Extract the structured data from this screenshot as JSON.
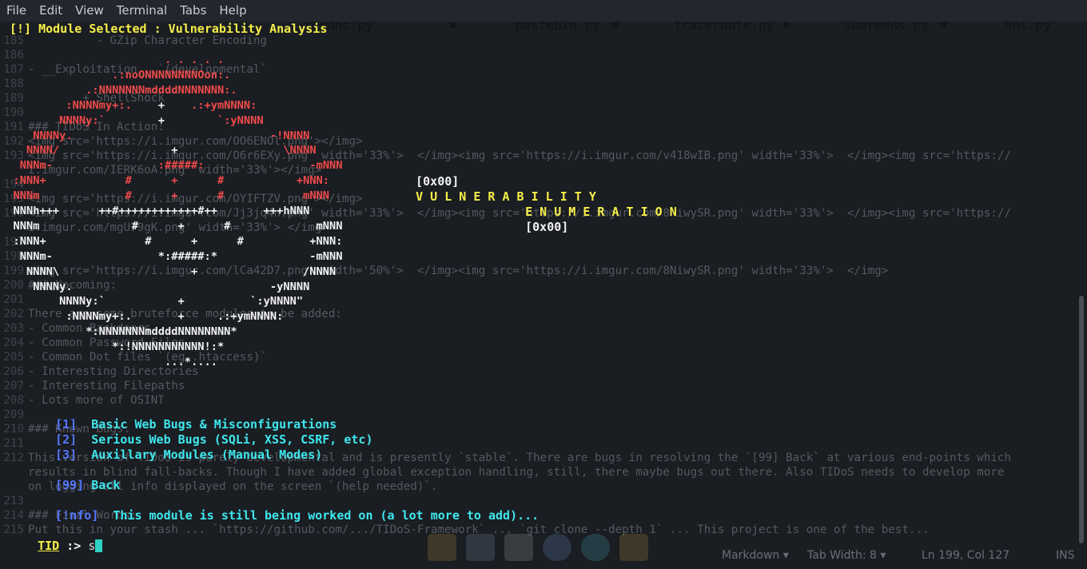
{
  "menubar": {
    "items": [
      "File",
      "Edit",
      "View",
      "Terminal",
      "Tabs",
      "Help"
    ]
  },
  "editor_tabs": [
    {
      "name": "revdns.py"
    },
    {
      "name": "pastebin.py"
    },
    {
      "name": "traceroute.py"
    },
    {
      "name": "sharedns.py"
    },
    {
      "name": "hhi.py"
    }
  ],
  "tab_close_glyph": "✖",
  "background_lines": [
    {
      "ln": "185",
      "text": "          - GZip Character Encoding"
    },
    {
      "ln": "186",
      "text": ""
    },
    {
      "ln": "187",
      "text": "- __Exploitation__ `(developmental`"
    },
    {
      "ln": "188",
      "text": ""
    },
    {
      "ln": "189",
      "text": "        + ShellShock"
    },
    {
      "ln": "190",
      "text": ""
    },
    {
      "ln": "191",
      "text": "### TIDoS In Action:"
    },
    {
      "ln": "192",
      "text": "<img src='https://i.imgur.com/OO6ENOl.png'></img>"
    },
    {
      "ln": "193",
      "text": "<img src='https://i.imgur.com/O6r6EXy.png' width='33%'>  </img><img src='https://i.imgur.com/v418wIB.png' width='33%'>  </img><img src='https://"
    },
    {
      "ln": "",
      "text": "i.imgur.com/IERK6oA.png' width='33%'></img>"
    },
    {
      "ln": "194",
      "text": ""
    },
    {
      "ln": "195",
      "text": "<img src='https://i.imgur.com/OYIFTZV.png'></img>"
    },
    {
      "ln": "196",
      "text": "<img src='https://i.imgur.com/Jj3jq4n.png' width='33%'>  </img><img src='https://i.imgur.com/8NiwySR.png' width='33%'>  </img><img src='https://"
    },
    {
      "ln": "",
      "text": "i.imgur.com/mgU79gK.png' width='33%'> </img>"
    },
    {
      "ln": "197",
      "text": ""
    },
    {
      "ln": "198",
      "text": ""
    },
    {
      "ln": "199",
      "text": "<img src='https://i.imgur.com/lCa42D7.png' width='50%'>  </img><img src='https://i.imgur.com/8NiwySR.png' width='33%'>  </img>"
    },
    {
      "ln": "200",
      "text": "### Upcoming:"
    },
    {
      "ln": "201",
      "text": ""
    },
    {
      "ln": "202",
      "text": "There are some bruteforce modules to be added:"
    },
    {
      "ln": "203",
      "text": "- Common Backdoors"
    },
    {
      "ln": "204",
      "text": "- Common Password Files"
    },
    {
      "ln": "205",
      "text": "- Common Dot files `(eg .htaccess)`"
    },
    {
      "ln": "206",
      "text": "- Interesting Directories"
    },
    {
      "ln": "207",
      "text": "- Interesting Filepaths"
    },
    {
      "ln": "208",
      "text": "- Lots more of OSINT"
    },
    {
      "ln": "209",
      "text": ""
    },
    {
      "ln": "210",
      "text": "### Known Bugs:"
    },
    {
      "ln": "211",
      "text": ""
    },
    {
      "ln": "212",
      "text": "This version of TIDoS is purely developmental and is presently `stable`. There are bugs in resolving the `[99] Back` at various end-points which"
    },
    {
      "ln": "",
      "text": "results in blind fall-backs. Though I have added global exception handling, still, there maybe bugs out there. Also TIDoS needs to develop more"
    },
    {
      "ln": "",
      "text": "on logging all info displayed on the screen `(help needed)`."
    },
    {
      "ln": "213",
      "text": ""
    },
    {
      "ln": "214",
      "text": "### Final Words:"
    },
    {
      "ln": "215",
      "text": "Put this in your stash ... `https://github.com/.../TIDoS-Framework` ... `git clone --depth 1` ... This project is one of the best..."
    }
  ],
  "terminal": {
    "header": "[!] Module Selected : Vulnerability Analysis",
    "art": [
      {
        "c": "red",
        "t": "                         . . . . ."
      },
      {
        "c": "red",
        "t": "                 .:noONNNNNNNNOon:."
      },
      {
        "c": "red",
        "t": "             .:NNNNNNNmddddNNNNNNN:."
      },
      {
        "c": "mix",
        "r": "          :NNNNmy+:.",
        "w": "    +",
        "r2": "    .:+ymNNNN:"
      },
      {
        "c": "mix",
        "r": "         NNNNy:`",
        "w": "        +",
        "r2": "        `:yNNNN"
      },
      {
        "c": "red",
        "t": "     NNNNy.                              -!NNNN"
      },
      {
        "c": "mix",
        "r": "    NNNN/",
        "w": "                 +",
        "r2": "                \\NNNN"
      },
      {
        "c": "mix",
        "r": "   NNNm-",
        "w": "                ",
        "r2": ":#####:",
        "w2": "",
        "r3": "                -mNNN"
      },
      {
        "c": "mix",
        "r": "  :NNN+",
        "w": "            ",
        "r2": "#      +      #",
        "r3": "           +NNN:"
      },
      {
        "c": "mix",
        "r": "  NNNm",
        "w": "             ",
        "r2": "#      +      #",
        "r3": "            mNNN"
      },
      {
        "c": "white",
        "t": "  NNNh+++      ++#++++++++++++#++       +++hNNN"
      },
      {
        "c": "white",
        "t": "  NNNm              #      +      #             mNNN"
      },
      {
        "c": "white",
        "t": "  :NNN+               #      +      #          +NNN:"
      },
      {
        "c": "white",
        "t": "   NNNm-                *:#####:*              -mNNN"
      },
      {
        "c": "white",
        "t": "    NNNN\\                    +                /NNNN"
      },
      {
        "c": "white",
        "t": "     NNNNy.                              -yNNNN"
      },
      {
        "c": "white",
        "t": "         NNNNy:`           +          `:yNNNN\""
      },
      {
        "c": "white",
        "t": "          :NNNNmy+:.       +     .:+ymNNNN:"
      },
      {
        "c": "white",
        "t": "             *:NNNNNNNmddddNNNNNNNN*"
      },
      {
        "c": "white",
        "t": "                 *:!NNNNNNNNNNN!:*"
      },
      {
        "c": "white",
        "t": "                         ...*...."
      }
    ],
    "vuln_line1_tag": "[0x00]",
    "vuln_line1_word": "V U L N E R A B I L I T Y",
    "vuln_line2_word": "E N U M E R A T I O N",
    "vuln_line2_tag": "[0x00]",
    "options": [
      {
        "num": "[1]",
        "label": "Basic Web Bugs & Misconfigurations"
      },
      {
        "num": "[2]",
        "label": "Serious Web Bugs (SQLi, XSS, CSRF, etc)"
      },
      {
        "num": "[3]",
        "label": "Auxillary Modules (Manual Modes)"
      }
    ],
    "back": {
      "num": "[99]",
      "label": "Back"
    },
    "info_tag": "[!nfo]",
    "info_text": "This module is still being worked on (a lot more to add)...",
    "prompt_tid": "TID",
    "prompt_arrow": ":>",
    "input_value": "s"
  },
  "statusbar": {
    "language": "Markdown",
    "tab_width": "Tab Width: 8",
    "position": "Ln 199, Col 127",
    "mode": "INS"
  },
  "colors": {
    "background": "#1a1d22",
    "header_yellow": "#f6ef4a",
    "art_red": "#ef4b4b",
    "option_blue": "#5577ff",
    "option_cyan": "#3ee8ee",
    "cursor": "#2fd3c6"
  }
}
